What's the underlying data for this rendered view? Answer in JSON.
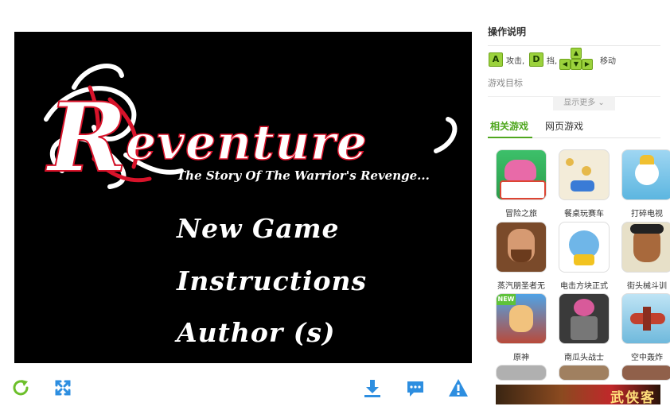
{
  "game": {
    "title": "Reventure",
    "subtitle": "The Story Of The Warrior's Revenge...",
    "menu": [
      {
        "label": "New Game"
      },
      {
        "label": "Instructions"
      },
      {
        "label": "Author (s)"
      }
    ]
  },
  "toolbar": {
    "refresh_icon": "refresh-icon",
    "fullscreen_icon": "fullscreen-icon",
    "download_icon": "download-icon",
    "comment_icon": "comment-icon",
    "report_icon": "warning-icon",
    "accent_color": "#6cbf2a",
    "blue_color": "#2d8ee0"
  },
  "panel": {
    "help_title": "操作说明",
    "controls": {
      "key_a": "A",
      "attack": "攻击,",
      "key_d": "D",
      "block": "挡,",
      "move": "移动"
    },
    "goal_label": "游戏目标",
    "show_more": "显示更多",
    "tabs": {
      "related": "相关游戏",
      "web": "网页游戏"
    },
    "games": [
      {
        "name": "冒险之旅"
      },
      {
        "name": "餐桌玩赛车"
      },
      {
        "name": "打碎电视"
      },
      {
        "name": "蒸汽朋圣者无"
      },
      {
        "name": "电击方块正式"
      },
      {
        "name": "街头械斗训"
      },
      {
        "name": "原神"
      },
      {
        "name": "南瓜头战士"
      },
      {
        "name": "空中轰炸"
      }
    ],
    "banner_text": "武侠客"
  }
}
